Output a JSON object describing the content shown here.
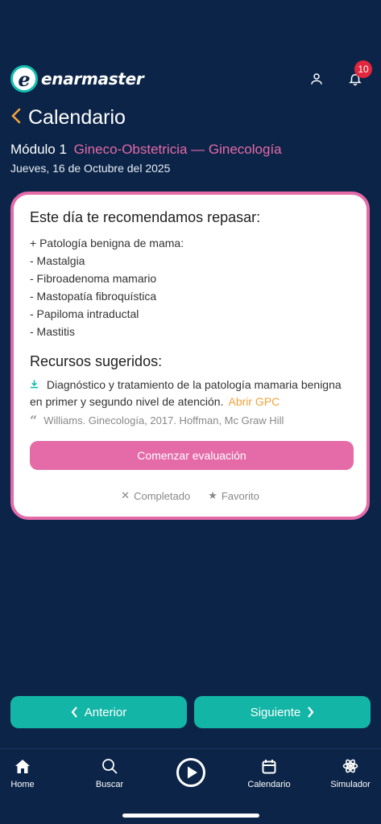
{
  "app": {
    "logo_letter": "e",
    "logo_text": "enarmaster"
  },
  "header": {
    "notification_count": "10"
  },
  "page": {
    "title": "Calendario",
    "module_label": "Módulo 1",
    "module_name": "Gineco-Obstetricia — Ginecología",
    "date": "Jueves, 16 de Octubre del 2025"
  },
  "card": {
    "heading": "Este día te recomendamos repasar:",
    "topics": [
      "+ Patología benigna de mama:",
      "- Mastalgia",
      "- Fibroadenoma mamario",
      "- Mastopatía fibroquística",
      "- Papiloma intraductal",
      "- Mastitis"
    ],
    "resources_heading": "Recursos sugeridos:",
    "resource_text": "Diagnóstico y tratamiento de la patología mamaria benigna en primer y segundo nivel de atención.",
    "resource_link": "Abrir GPC",
    "reference": "Williams. Ginecología, 2017. Hoffman, Mc Graw Hill",
    "start_button": "Comenzar evaluación",
    "completed_label": "Completado",
    "favorite_label": "Favorito"
  },
  "nav": {
    "prev_label": "Anterior",
    "next_label": "Siguiente"
  },
  "tabbar": {
    "home": "Home",
    "search": "Buscar",
    "calendar": "Calendario",
    "simulator": "Simulador"
  },
  "colors": {
    "background": "#0b2447",
    "accent_pink": "#e56aa8",
    "accent_teal": "#13b6a6",
    "link_orange": "#f2a23a",
    "badge_red": "#e2263d"
  },
  "icons": {
    "profile": "user-icon",
    "notifications": "bell-icon",
    "back": "chevron-left-icon",
    "download": "download-icon",
    "quote": "quote-icon",
    "completed": "close-icon",
    "favorite": "star-icon",
    "home": "home-icon",
    "search": "search-icon",
    "play": "play-icon",
    "calendar": "calendar-icon",
    "simulator": "atom-icon"
  }
}
